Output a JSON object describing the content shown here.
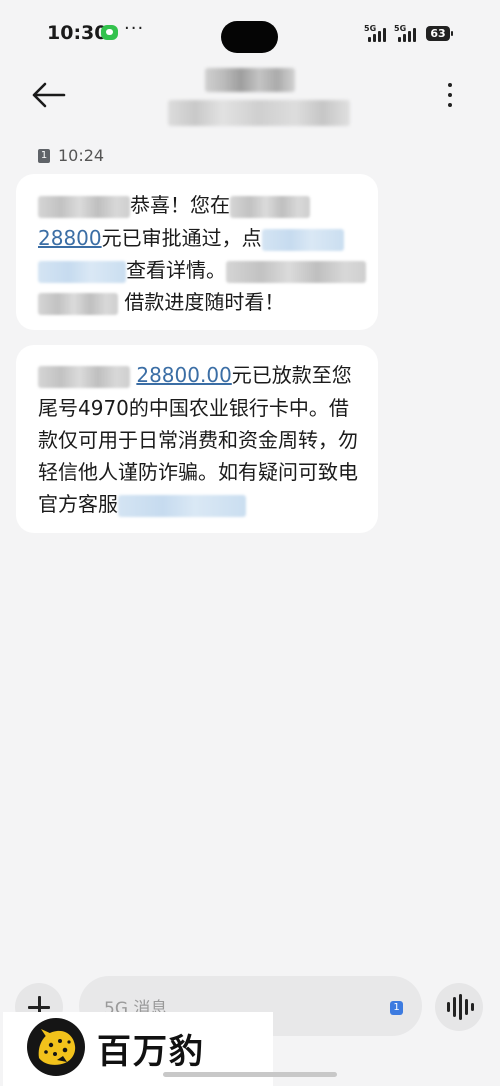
{
  "status_bar": {
    "time": "10:30",
    "more": "···",
    "network_1": "5G",
    "network_2": "5G",
    "battery": "63"
  },
  "header": {
    "contact_name": "",
    "contact_number": ""
  },
  "thread": {
    "sim_slot": "1",
    "timestamp": "10:24"
  },
  "messages": [
    {
      "lines": [
        {
          "after_blur": "恭喜！您在"
        },
        {
          "link": "28800",
          "text": "元已审批通过，点"
        },
        {
          "text": "查看详情。"
        },
        {
          "text": "借款进度随时看！"
        }
      ]
    },
    {
      "lines": [
        {
          "link": "28800.00",
          "text": "元已放款至您"
        },
        {
          "text": "尾号4970的中国农业银行卡中。借"
        },
        {
          "text": "款仅可用于日常消费和资金周转，勿"
        },
        {
          "text": "轻信他人谨防诈骗。如有疑问可致电"
        },
        {
          "text": "官方客服"
        }
      ]
    }
  ],
  "composer": {
    "placeholder": "5G 消息",
    "sim_badge": "1"
  },
  "watermark": {
    "text": "百万豹"
  },
  "colors": {
    "background": "#f4f4f5",
    "bubble": "#ffffff",
    "link": "#3b6ea5",
    "sim_badge_active": "#3d7be0"
  }
}
